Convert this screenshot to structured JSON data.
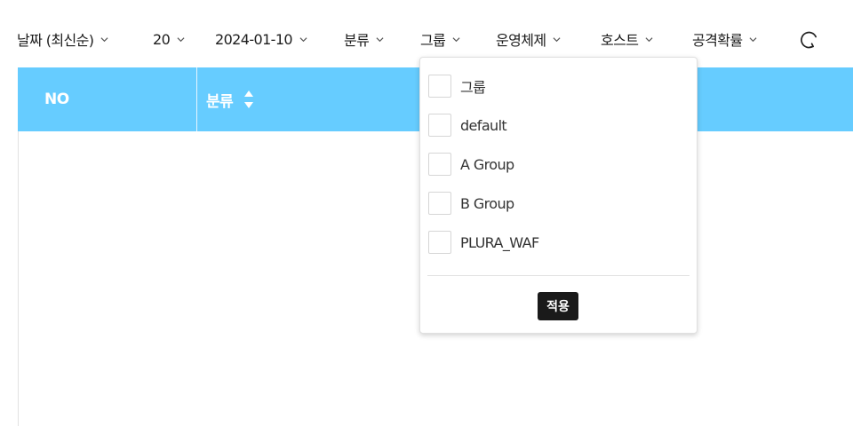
{
  "filters": [
    {
      "label": "날짜 (최신순)"
    },
    {
      "label": "20"
    },
    {
      "label": "2024-01-10"
    },
    {
      "label": "분류"
    },
    {
      "label": "그룹"
    },
    {
      "label": "운영체제"
    },
    {
      "label": "호스트"
    },
    {
      "label": "공격확률"
    }
  ],
  "table": {
    "columns": [
      {
        "label": "NO"
      },
      {
        "label": "분류"
      }
    ],
    "header_color": "#66ccff"
  },
  "group_dropdown": {
    "options": [
      {
        "label": "그룹",
        "checked": false
      },
      {
        "label": "default",
        "checked": false
      },
      {
        "label": "A Group",
        "checked": false
      },
      {
        "label": "B Group",
        "checked": false
      },
      {
        "label": "PLURA_WAF",
        "checked": false
      }
    ],
    "apply_label": "적용"
  },
  "icons": {
    "filter_chevron": "chevron-down-icon",
    "refresh": "refresh-icon",
    "sort": "sort-icon"
  }
}
